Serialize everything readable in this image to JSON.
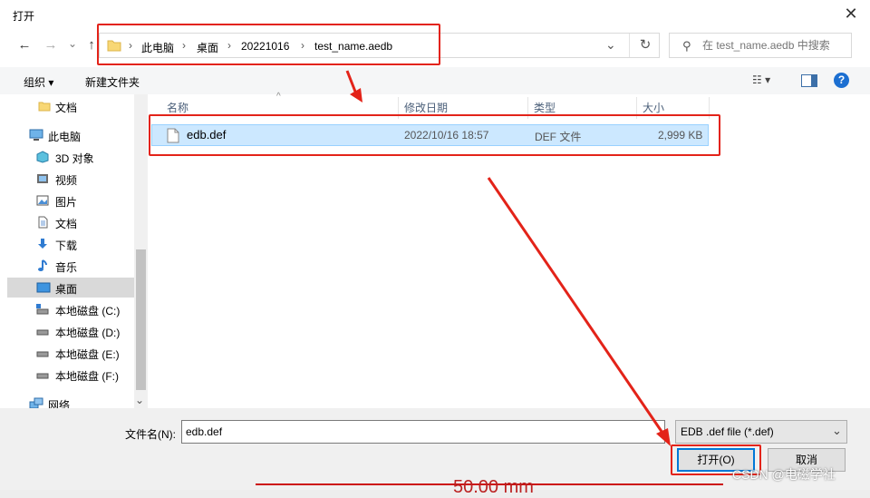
{
  "window": {
    "title": "打开",
    "close_glyph": "✕"
  },
  "nav": {
    "back": "←",
    "forward": "→",
    "dropdown": "⌄",
    "up": "↑"
  },
  "address": {
    "crumbs": [
      "此电脑",
      "桌面",
      "20221016",
      "test_name.aedb"
    ],
    "separator": "›",
    "dropdown": "⌄",
    "refresh": "↻"
  },
  "search": {
    "placeholder": "在 test_name.aedb 中搜索",
    "icon": "⚲"
  },
  "toolbar": {
    "organize": "组织 ▾",
    "new_folder": "新建文件夹",
    "view_glyph": "☷ ▾",
    "help_glyph": "?"
  },
  "sidebar": {
    "items": [
      {
        "label": "文档",
        "icon": "folder-icon"
      },
      {
        "label": "此电脑",
        "icon": "computer-icon"
      },
      {
        "label": "3D 对象",
        "icon": "cube-icon"
      },
      {
        "label": "视频",
        "icon": "video-icon"
      },
      {
        "label": "图片",
        "icon": "picture-icon"
      },
      {
        "label": "文档",
        "icon": "document-icon"
      },
      {
        "label": "下载",
        "icon": "download-icon"
      },
      {
        "label": "音乐",
        "icon": "music-icon"
      },
      {
        "label": "桌面",
        "icon": "desktop-icon",
        "selected": true
      },
      {
        "label": "本地磁盘 (C:)",
        "icon": "drive-c-icon"
      },
      {
        "label": "本地磁盘 (D:)",
        "icon": "drive-icon"
      },
      {
        "label": "本地磁盘 (E:)",
        "icon": "drive-icon"
      },
      {
        "label": "本地磁盘 (F:)",
        "icon": "drive-icon"
      },
      {
        "label": "网络",
        "icon": "network-icon"
      }
    ],
    "scroll_down": "⌄"
  },
  "file_list": {
    "columns": [
      "名称",
      "修改日期",
      "类型",
      "大小"
    ],
    "sort_glyph": "^",
    "rows": [
      {
        "name": "edb.def",
        "modified": "2022/10/16 18:57",
        "type": "DEF 文件",
        "size": "2,999 KB"
      }
    ]
  },
  "bottom": {
    "filename_label": "文件名(N):",
    "filename_value": "edb.def",
    "filetype_value": "EDB .def file (*.def)",
    "filetype_arrow": "⌄",
    "open_label": "打开(O)",
    "cancel_label": "取消"
  },
  "overlay": {
    "watermark": "CSDN @电磁学社",
    "dimension_text": "50.00 mm"
  },
  "colors": {
    "annotation_red": "#e32319",
    "selection": "#cce8ff",
    "accent": "#0078d7"
  }
}
